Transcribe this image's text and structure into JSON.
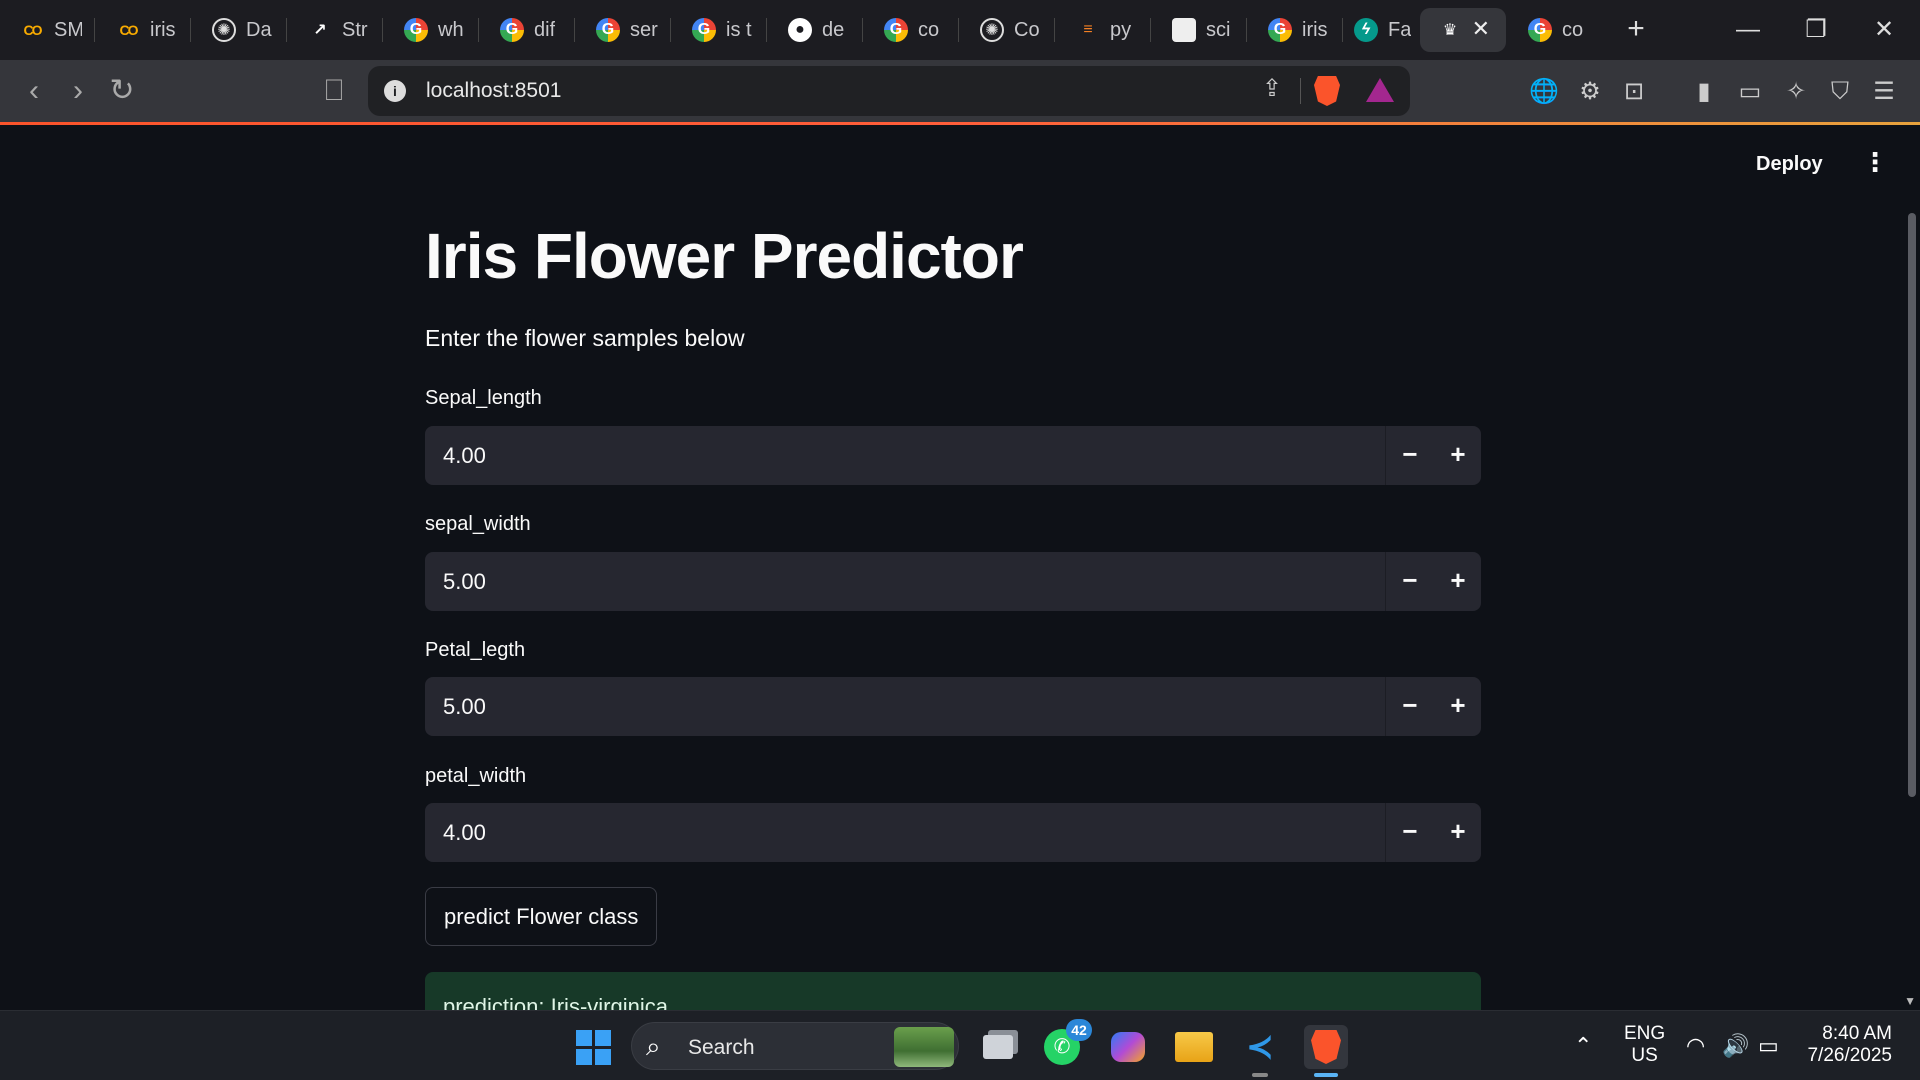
{
  "browser": {
    "tabs": [
      {
        "icon": "colab-icon",
        "glyph": "CO",
        "title": "SM",
        "style": "fav-co"
      },
      {
        "icon": "colab-icon",
        "glyph": "CO",
        "title": "iris",
        "style": "fav-co"
      },
      {
        "icon": "chatgpt-icon",
        "glyph": "✺",
        "title": "Da",
        "style": "fav-gpt"
      },
      {
        "icon": "streamlit-icon",
        "glyph": "↗",
        "title": "Str",
        "style": "fav-st"
      },
      {
        "icon": "google-icon",
        "glyph": "G",
        "title": "wh",
        "style": "fav-g"
      },
      {
        "icon": "google-icon",
        "glyph": "G",
        "title": "dif",
        "style": "fav-g"
      },
      {
        "icon": "google-icon",
        "glyph": "G",
        "title": "ser",
        "style": "fav-g"
      },
      {
        "icon": "google-icon",
        "glyph": "G",
        "title": "is t",
        "style": "fav-g"
      },
      {
        "icon": "github-icon",
        "glyph": "●",
        "title": "de",
        "style": "fav-gh"
      },
      {
        "icon": "google-icon",
        "glyph": "G",
        "title": "co",
        "style": "fav-g"
      },
      {
        "icon": "chatgpt-icon",
        "glyph": "✺",
        "title": "Co",
        "style": "fav-gpt"
      },
      {
        "icon": "stackoverflow-icon",
        "glyph": "≡",
        "title": "py",
        "style": "fav-so"
      },
      {
        "icon": "box-icon",
        "glyph": "",
        "title": "sci",
        "style": "fav-box"
      },
      {
        "icon": "google-icon",
        "glyph": "G",
        "title": "iris",
        "style": "fav-g"
      },
      {
        "icon": "fastapi-icon",
        "glyph": "ϟ",
        "title": "Fa",
        "style": "fav-fa"
      }
    ],
    "active_tab": {
      "icon": "crown-icon",
      "glyph": "♛",
      "title": ""
    },
    "last_tab": {
      "icon": "google-icon",
      "glyph": "G",
      "title": "co"
    },
    "new_tab": "+",
    "window": {
      "minimize": "—",
      "restore": "❐",
      "close": "✕"
    },
    "nav": {
      "back": "‹",
      "forward": "›",
      "reload": "↻",
      "bookmark": "⎕"
    },
    "url": "localhost:8501",
    "info_glyph": "i",
    "share_glyph": "⇪",
    "toolbar_icons": [
      {
        "name": "translate-icon",
        "glyph": "🌐"
      },
      {
        "name": "extensions-icon",
        "glyph": "⚙"
      },
      {
        "name": "screenshot-icon",
        "glyph": "⊡"
      },
      {
        "name": "sidebar-icon",
        "glyph": "▮"
      },
      {
        "name": "wallet-icon",
        "glyph": "▭"
      },
      {
        "name": "leo-ai-icon",
        "glyph": "✧"
      },
      {
        "name": "vpn-shield-icon",
        "glyph": "⛉"
      },
      {
        "name": "menu-icon",
        "glyph": "☰"
      }
    ]
  },
  "app": {
    "deploy_label": "Deploy",
    "menu_glyph": "⋮",
    "title": "Iris Flower Predictor",
    "subtitle": "Enter the flower samples below",
    "fields": [
      {
        "label": "Sepal_length",
        "value": "4.00"
      },
      {
        "label": "sepal_width",
        "value": "5.00"
      },
      {
        "label": "Petal_legth",
        "value": "5.00"
      },
      {
        "label": "petal_width",
        "value": "4.00"
      }
    ],
    "stepper": {
      "minus": "−",
      "plus": "+"
    },
    "predict_label": "predict Flower class",
    "result_text": "prediction: Iris-virginica"
  },
  "taskbar": {
    "search_label": "Search",
    "whatsapp_badge": "42",
    "lang_line1": "ENG",
    "lang_line2": "US",
    "time": "8:40 AM",
    "date": "7/26/2025"
  }
}
